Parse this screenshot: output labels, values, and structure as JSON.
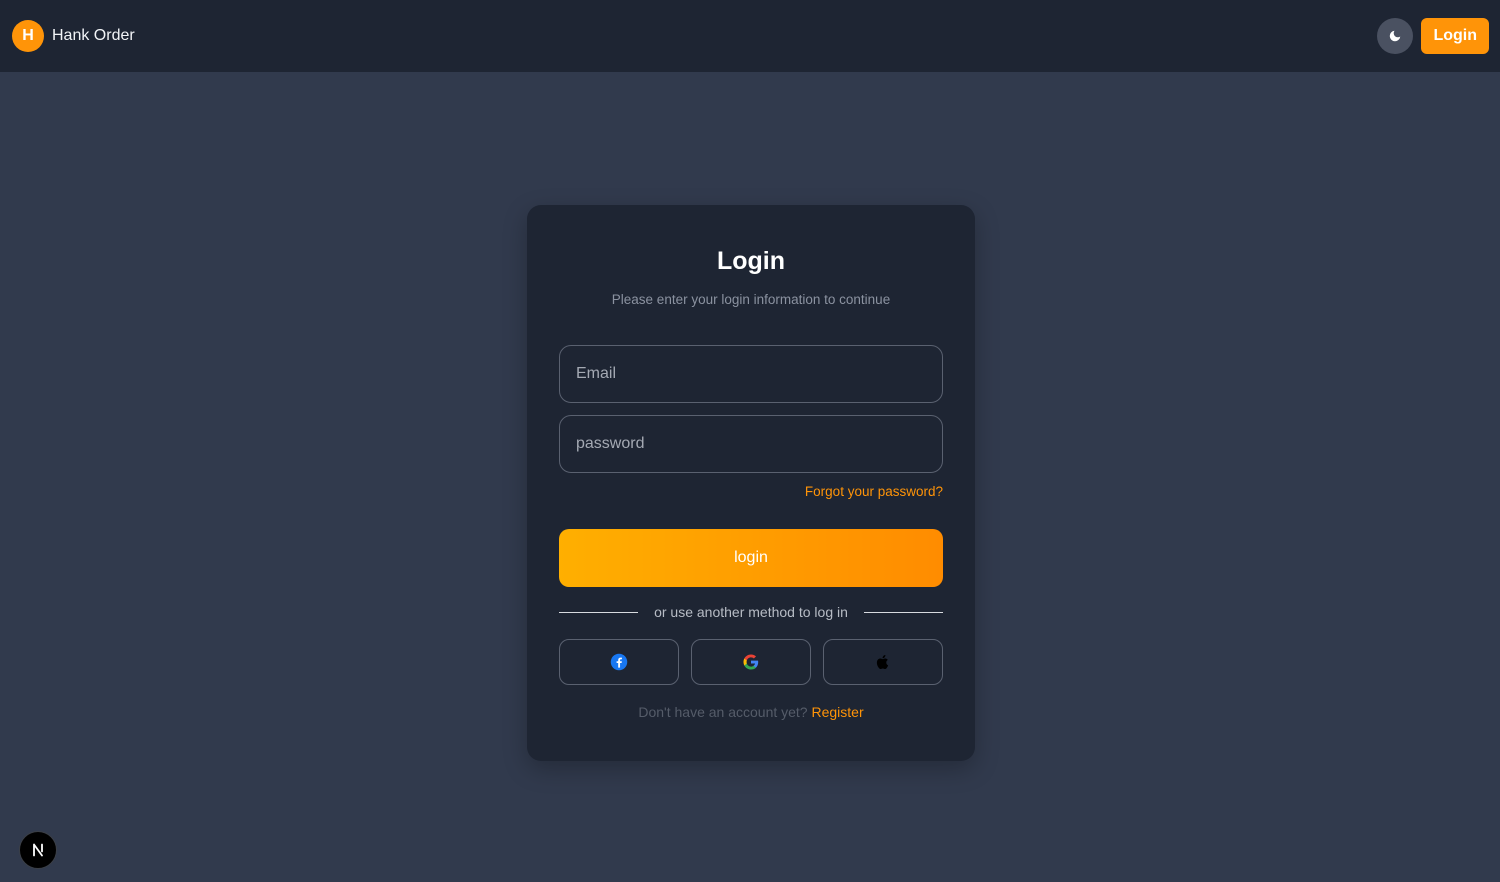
{
  "header": {
    "brand_initial": "H",
    "brand_name": "Hank Order",
    "login_label": "Login",
    "theme_icon": "moon-icon"
  },
  "login_card": {
    "title": "Login",
    "subtitle": "Please enter your login information to continue",
    "email_placeholder": "Email",
    "password_placeholder": "password",
    "forgot_password": "Forgot your password?",
    "submit_label": "login",
    "divider_text": "or use another method to log in",
    "social_buttons": [
      {
        "icon": "facebook-icon",
        "color": "#1877f2"
      },
      {
        "icon": "google-icon"
      },
      {
        "icon": "apple-icon",
        "color": "#000000"
      }
    ],
    "no_account_text": "Don't have an account yet?",
    "register_label": "Register"
  },
  "dev_badge": {
    "letter": "N",
    "icon": "nextjs-icon"
  },
  "colors": {
    "accent": "#ff9408",
    "header_bg": "#1e2533",
    "page_bg": "#313a4d",
    "card_bg": "#1e2533"
  }
}
